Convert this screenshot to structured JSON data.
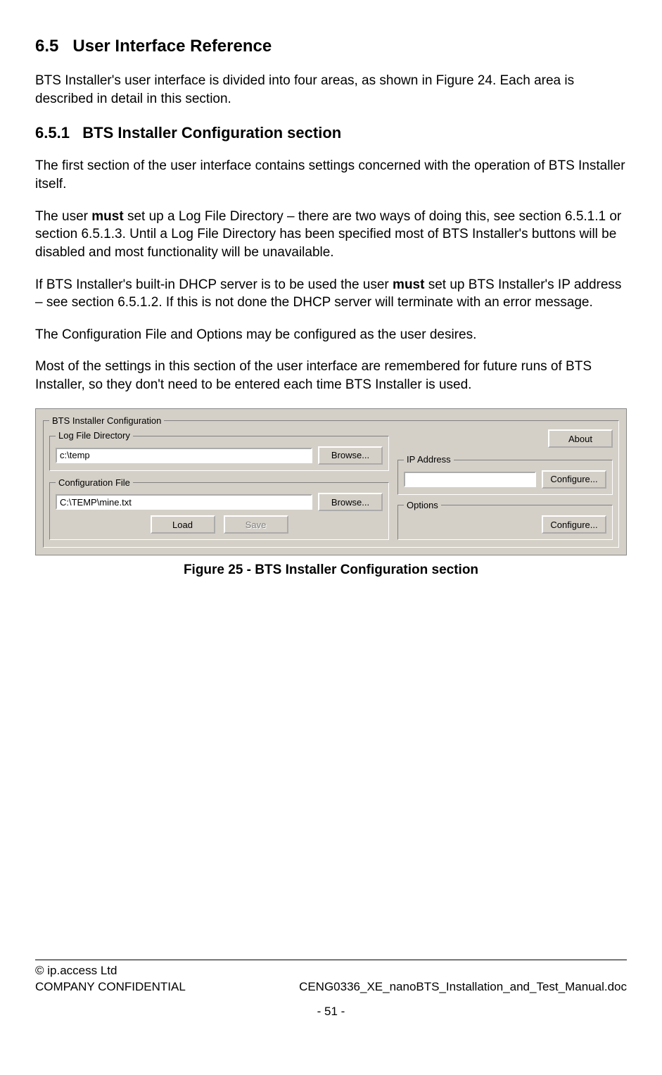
{
  "headings": {
    "h65_num": "6.5",
    "h65_title": "User Interface Reference",
    "h651_num": "6.5.1",
    "h651_title": "BTS Installer Configuration section"
  },
  "paras": {
    "p1": "BTS Installer's user interface is divided into four areas, as shown in Figure 24. Each area is described in detail in this section.",
    "p2": "The first section of the user interface contains settings concerned with the operation of BTS Installer itself.",
    "p3a": "The user ",
    "p3_must": "must",
    "p3b": " set up a Log File Directory – there are two ways of doing this, see section 6.5.1.1 or section 6.5.1.3. Until a Log File Directory has been specified most of BTS Installer's buttons will be disabled and most functionality will be unavailable.",
    "p4a": "If BTS Installer's built-in DHCP server is to be used the user ",
    "p4_must": "must",
    "p4b": " set up BTS Installer's IP address – see section 6.5.1.2. If this is not done the DHCP server will terminate with an error message.",
    "p5": "The Configuration File and Options may be configured as the user desires.",
    "p6": "Most of the settings in this section of the user interface are remembered for future runs of BTS Installer, so they don't need to be entered each time BTS Installer is used."
  },
  "ui": {
    "outer_legend": "BTS Installer Configuration",
    "log_legend": "Log File Directory",
    "log_value": "c:\\temp",
    "cfg_legend": "Configuration File",
    "cfg_value": "C:\\TEMP\\mine.txt",
    "browse": "Browse...",
    "load": "Load",
    "save": "Save",
    "about": "About",
    "ip_legend": "IP Address",
    "ip_value": "",
    "ip_configure": "Configure...",
    "opts_legend": "Options",
    "opts_configure": "Configure..."
  },
  "caption": "Figure 25 - BTS Installer Configuration section",
  "footer": {
    "copyright": "© ip.access Ltd",
    "confidential": "COMPANY CONFIDENTIAL",
    "docname": "CENG0336_XE_nanoBTS_Installation_and_Test_Manual.doc",
    "page": "- 51 -"
  }
}
